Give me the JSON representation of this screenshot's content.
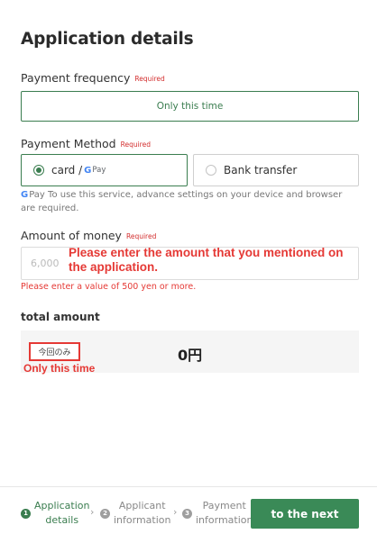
{
  "page_title": "Application details",
  "required_label": "Required",
  "payment_frequency": {
    "label": "Payment frequency",
    "selected_option": "Only this time"
  },
  "payment_method": {
    "label": "Payment Method",
    "options": [
      {
        "label": "card /",
        "brand": "Pay",
        "brand_icon": "google-g-icon",
        "selected": true
      },
      {
        "label": "Bank transfer",
        "selected": false
      }
    ],
    "gpay_note_brand": "Pay",
    "gpay_note": "To use this service, advance settings on your device and browser are required."
  },
  "amount_of_money": {
    "label": "Amount of money",
    "placeholder": "6,000",
    "annotation": "Please enter the amount that you mentioned on the application.",
    "error": "Please enter a value of 500 yen or more."
  },
  "total": {
    "label": "total amount",
    "badge": "今回のみ",
    "badge_annotation": "Only this time",
    "value": "0円"
  },
  "footer": {
    "steps": [
      {
        "number": "1",
        "label": "Application\ndetails",
        "active": true
      },
      {
        "number": "2",
        "label": "Applicant\ninformation",
        "active": false
      },
      {
        "number": "3",
        "label": "Payment\ninformation",
        "active": false
      }
    ],
    "next_button": "to the next"
  },
  "colors": {
    "accent": "#3a7d4f",
    "button": "#3a8a57",
    "required": "#d32f2f",
    "annotation": "#e53935",
    "google_blue": "#4285f4"
  }
}
